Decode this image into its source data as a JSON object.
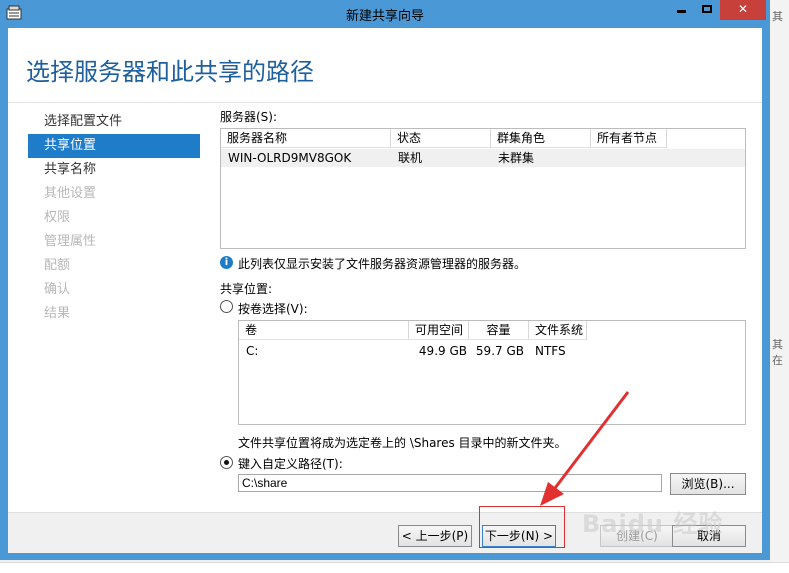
{
  "window": {
    "title": "新建共享向导",
    "controls": {
      "minimize": "",
      "maximize": "",
      "close": "✕"
    }
  },
  "page": {
    "heading": "选择服务器和此共享的路径"
  },
  "nav": {
    "items": [
      {
        "label": "选择配置文件",
        "state": "normal"
      },
      {
        "label": "共享位置",
        "state": "active"
      },
      {
        "label": "共享名称",
        "state": "normal"
      },
      {
        "label": "其他设置",
        "state": "disabled"
      },
      {
        "label": "权限",
        "state": "disabled"
      },
      {
        "label": "管理属性",
        "state": "disabled"
      },
      {
        "label": "配额",
        "state": "disabled"
      },
      {
        "label": "确认",
        "state": "disabled"
      },
      {
        "label": "结果",
        "state": "disabled"
      }
    ]
  },
  "servers": {
    "label": "服务器(S):",
    "columns": [
      "服务器名称",
      "状态",
      "群集角色",
      "所有者节点"
    ],
    "rows": [
      {
        "name": "WIN-OLRD9MV8GOK",
        "status": "联机",
        "cluster_role": "未群集",
        "owner_node": ""
      }
    ],
    "info_text": "此列表仅显示安装了文件服务器资源管理器的服务器。"
  },
  "share_location": {
    "label": "共享位置:",
    "by_volume": {
      "label": "按卷选择(V):",
      "selected": false,
      "columns": [
        "卷",
        "可用空间",
        "容量",
        "文件系统"
      ],
      "rows": [
        {
          "volume": "C:",
          "free": "49.9 GB",
          "capacity": "59.7 GB",
          "fs": "NTFS"
        }
      ],
      "note": "文件共享位置将成为选定卷上的 \\Shares 目录中的新文件夹。"
    },
    "custom_path": {
      "label": "键入自定义路径(T):",
      "selected": true,
      "value": "C:\\share"
    },
    "browse_label": "浏览(B)..."
  },
  "footer": {
    "prev": "< 上一步(P)",
    "next": "下一步(N) >",
    "create": "创建(C)",
    "cancel": "取消"
  },
  "overlay": {
    "watermark": "Baidu 经验",
    "arrow_color": "#e03030",
    "bg_fragments": [
      "其",
      "其在"
    ]
  },
  "colors": {
    "accent": "#1f7cc9",
    "heading": "#1e5f9e",
    "titlebar": "#4a98d6",
    "close": "#c7403a"
  }
}
